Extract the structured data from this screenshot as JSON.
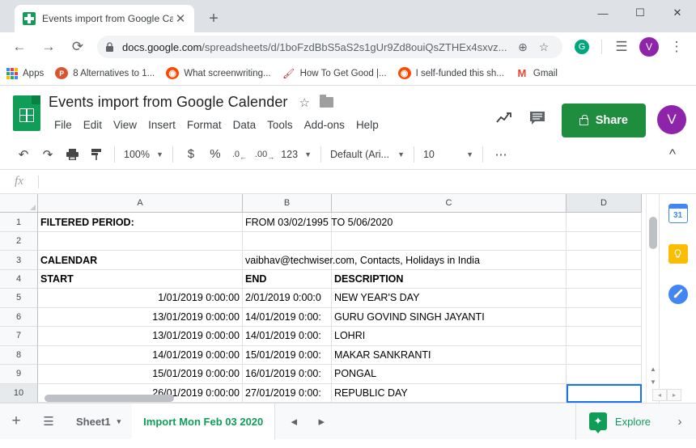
{
  "browser": {
    "tab": {
      "title": "Events import from Google Calen",
      "favicon": "sheets-favicon",
      "close": "✕"
    },
    "new_tab": "+",
    "window_controls": {
      "minimize": "—",
      "maximize": "☐",
      "close": "✕"
    },
    "nav": {
      "back": "←",
      "forward": "→",
      "reload": "⟳"
    },
    "omnibox": {
      "lock": "🔒",
      "url_domain": "docs.google.com",
      "url_path": "/spreadsheets/d/1boFzdBbS5aS2s1gUr9Zd8ouiQsZTHEx4sxvz...",
      "zoom_icon": "⊕",
      "bookmark_star": "☆"
    },
    "toolbar_right": {
      "extension_badge": "G",
      "media_icon": "☰",
      "profile_initial": "V",
      "menu_dots": "⋮"
    },
    "bookmarks": [
      {
        "label": "Apps",
        "icon": "apps-grid-icon",
        "color": "#4285f4"
      },
      {
        "label": "8 Alternatives to 1...",
        "icon": "product-hunt-icon",
        "color": "#da552f",
        "glyph": "P"
      },
      {
        "label": "What screenwriting...",
        "icon": "reddit-icon",
        "color": "#ff4500",
        "glyph": "●"
      },
      {
        "label": "How To Get Good |...",
        "icon": "site-icon",
        "color": "#ffffff",
        "glyph": "✒"
      },
      {
        "label": "I self-funded this sh...",
        "icon": "reddit-icon",
        "color": "#ff4500",
        "glyph": "●"
      },
      {
        "label": "Gmail",
        "icon": "gmail-icon",
        "color": "#ea4335",
        "glyph": "M"
      }
    ]
  },
  "sheets": {
    "doc_title": "Events import from Google Calender",
    "star_icon": "☆",
    "folder_icon": "move-to-folder-icon",
    "menus": [
      "File",
      "Edit",
      "View",
      "Insert",
      "Format",
      "Data",
      "Tools",
      "Add-ons",
      "Help"
    ],
    "header_icons": {
      "activity": "↗",
      "comments": "💬"
    },
    "share_label": "Share",
    "avatar_initial": "V",
    "toolbar": {
      "undo": "↶",
      "redo": "↷",
      "print": "⎙",
      "paint_format": "paint-format-icon",
      "zoom_value": "100%",
      "currency": "$",
      "percent": "%",
      "decrease_decimal": ".0",
      "increase_decimal": ".00",
      "more_formats": "123",
      "font_family": "Default (Ari...",
      "font_size": "10",
      "more": "⋯",
      "collapse": "⌃"
    },
    "formula_bar": {
      "fx": "fx",
      "value": ""
    },
    "grid": {
      "columns": [
        "A",
        "B",
        "C",
        "D"
      ],
      "selected_column": "D",
      "rows": [
        {
          "n": "1",
          "a": "FILTERED PERIOD:",
          "b": "FROM 03/02/1995 TO 5/06/2020",
          "c": "",
          "d": "",
          "bold_a": true
        },
        {
          "n": "2",
          "a": "",
          "b": "",
          "c": "",
          "d": ""
        },
        {
          "n": "3",
          "a": "CALENDAR",
          "b": "vaibhav@techwiser.com, Contacts, Holidays in India",
          "c": "",
          "d": "",
          "bold_a": true
        },
        {
          "n": "4",
          "a": "START",
          "b": "END",
          "c": "DESCRIPTION",
          "d": "",
          "bold_a": true,
          "bold_b": true,
          "bold_c": true
        },
        {
          "n": "5",
          "a": "1/01/2019 0:00:00",
          "b": "2/01/2019 0:00:0",
          "c": "NEW YEAR'S DAY",
          "d": "",
          "num_a": true
        },
        {
          "n": "6",
          "a": "13/01/2019 0:00:00",
          "b": "14/01/2019 0:00:",
          "c": "GURU GOVIND SINGH JAYANTI",
          "d": "",
          "num_a": true
        },
        {
          "n": "7",
          "a": "13/01/2019 0:00:00",
          "b": "14/01/2019 0:00:",
          "c": "LOHRI",
          "d": "",
          "num_a": true
        },
        {
          "n": "8",
          "a": "14/01/2019 0:00:00",
          "b": "15/01/2019 0:00:",
          "c": "MAKAR SANKRANTI",
          "d": "",
          "num_a": true
        },
        {
          "n": "9",
          "a": "15/01/2019 0:00:00",
          "b": "16/01/2019 0:00:",
          "c": "PONGAL",
          "d": "",
          "num_a": true
        },
        {
          "n": "10",
          "a": "26/01/2019 0:00:00",
          "b": "27/01/2019 0:00:",
          "c": "REPUBLIC DAY",
          "d": "",
          "num_a": true,
          "selected_d": true
        }
      ]
    },
    "rail": [
      {
        "name": "calendar-icon",
        "glyph": "31"
      },
      {
        "name": "keep-icon",
        "glyph": "💡"
      },
      {
        "name": "tasks-icon",
        "glyph": "✓"
      }
    ],
    "bottom": {
      "add_sheet": "+",
      "all_sheets": "☰",
      "tabs": [
        {
          "label": "Sheet1",
          "active": false,
          "caret": "▾"
        },
        {
          "label": "Import Mon Feb 03 2020",
          "active": true
        }
      ],
      "prev_arrow": "◂",
      "next_arrow": "▸",
      "explore_label": "Explore",
      "explore_glyph": "✦",
      "expand": "›"
    }
  }
}
